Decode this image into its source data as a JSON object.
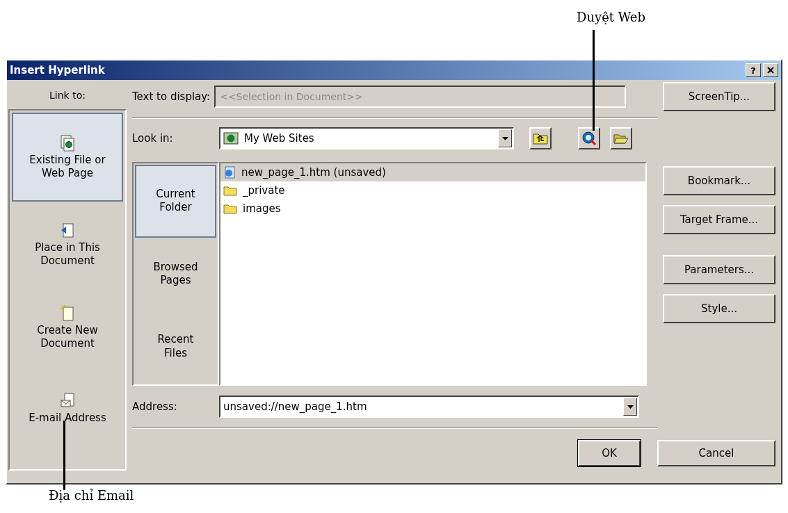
{
  "annotation_top": "Duyệt Web",
  "annotation_bottom": "Địa chỉ Email",
  "window": {
    "title": "Insert Hyperlink",
    "help_button": "?"
  },
  "link_to": {
    "label": "Link to:",
    "items": [
      {
        "label": "Existing File or\nWeb Page",
        "kind": "file",
        "selected": true
      },
      {
        "label": "Place in This\nDocument",
        "kind": "place",
        "selected": false
      },
      {
        "label": "Create New\nDocument",
        "kind": "new",
        "selected": false
      },
      {
        "label": "E-mail Address",
        "kind": "email",
        "selected": false
      }
    ]
  },
  "text_to_display": {
    "label": "Text to display:",
    "value": "<<Selection in Document>>",
    "disabled": true
  },
  "look_in": {
    "label": "Look in:",
    "value": "My Web Sites"
  },
  "places": [
    {
      "label": "Current\nFolder",
      "selected": true
    },
    {
      "label": "Browsed\nPages",
      "selected": false
    },
    {
      "label": "Recent\nFiles",
      "selected": false
    }
  ],
  "files": [
    {
      "name": "new_page_1.htm (unsaved)",
      "kind": "page",
      "selected": true
    },
    {
      "name": "_private",
      "kind": "folder",
      "selected": false
    },
    {
      "name": "images",
      "kind": "folder",
      "selected": false
    }
  ],
  "address": {
    "label": "Address:",
    "value": "unsaved://new_page_1.htm"
  },
  "side_buttons": [
    "ScreenTip...",
    "Bookmark...",
    "Target Frame...",
    "Parameters...",
    "Style..."
  ],
  "dialog_buttons": [
    {
      "label": "OK",
      "default": true
    },
    {
      "label": "Cancel",
      "default": false
    }
  ]
}
